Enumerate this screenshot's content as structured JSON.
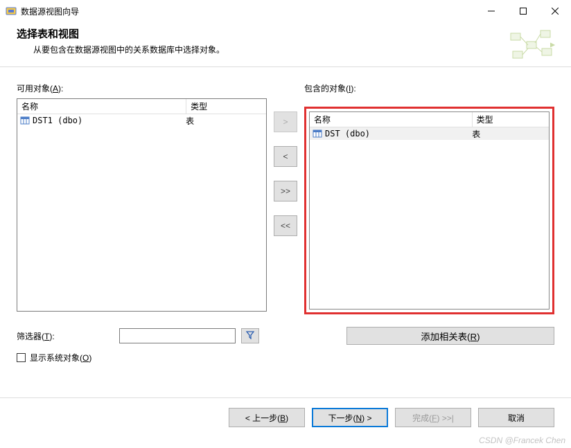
{
  "titlebar": {
    "title": "数据源视图向导"
  },
  "header": {
    "heading": "选择表和视图",
    "subtitle": "从要包含在数据源视图中的关系数据库中选择对象。"
  },
  "available": {
    "label_prefix": "可用对象(",
    "mnemonic": "A",
    "label_suffix": "):",
    "columns": {
      "name": "名称",
      "type": "类型"
    },
    "rows": [
      {
        "name": "DST1 (dbo)",
        "type": "表"
      }
    ]
  },
  "included": {
    "label_prefix": "包含的对象(",
    "mnemonic": "I",
    "label_suffix": "):",
    "columns": {
      "name": "名称",
      "type": "类型"
    },
    "rows": [
      {
        "name": "DST (dbo)",
        "type": "表"
      }
    ]
  },
  "transfer": {
    "add": ">",
    "remove": "<",
    "add_all": ">>",
    "remove_all": "<<"
  },
  "filter": {
    "label_prefix": "筛选器(",
    "mnemonic": "T",
    "label_suffix": "):",
    "value": ""
  },
  "related": {
    "label_prefix": "添加相关表(",
    "mnemonic": "R",
    "label_suffix": ")"
  },
  "syscheck": {
    "label_prefix": "显示系统对象(",
    "mnemonic": "O",
    "label_suffix": ")",
    "checked": false
  },
  "footer": {
    "back_prefix": "< 上一步(",
    "back_mnem": "B",
    "back_suffix": ")",
    "next_prefix": "下一步(",
    "next_mnem": "N",
    "next_suffix": ") >",
    "finish_prefix": "完成(",
    "finish_mnem": "F",
    "finish_suffix": ") >>|",
    "cancel": "取消"
  },
  "watermark": "CSDN @Francek Chen"
}
